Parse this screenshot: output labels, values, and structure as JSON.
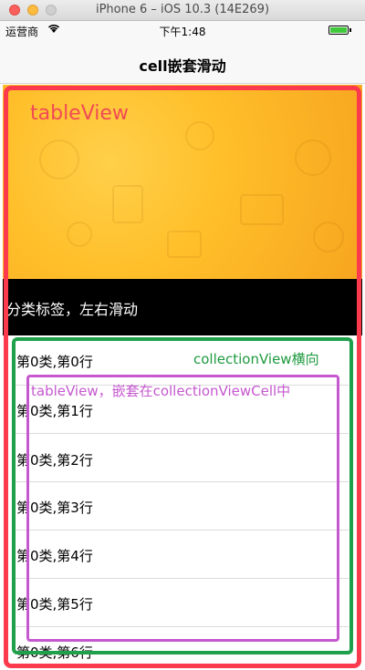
{
  "simulator": {
    "title": "iPhone 6 – iOS 10.3 (14E269)"
  },
  "statusbar": {
    "carrier": "运营商",
    "time": "下午1:48"
  },
  "navbar": {
    "title": "cell嵌套滑动"
  },
  "banner": {
    "category_bar_text": "分类标签，左右滑动"
  },
  "annotations": {
    "outer": "tableView",
    "middle": "collectionView横向",
    "inner": "tableView，嵌套在collectionViewCell中"
  },
  "rows": [
    "第0类,第0行",
    "第0类,第1行",
    "第0类,第2行",
    "第0类,第3行",
    "第0类,第4行",
    "第0类,第5行",
    "第0类,第6行"
  ],
  "colors": {
    "outer_frame": "#fb3a4d",
    "middle_frame": "#1fa04a",
    "inner_frame": "#c558cf",
    "banner": "#ffc22e"
  }
}
